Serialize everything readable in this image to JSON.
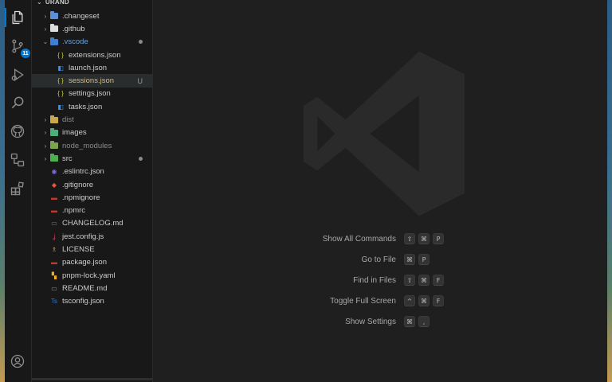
{
  "explorer": {
    "section_title": "URAND",
    "items": [
      {
        "label": ".changeset",
        "type": "folder",
        "chevron": "›",
        "depth": 0,
        "icon_color": "#5b8fd6",
        "icon": "folder-changeset-icon"
      },
      {
        "label": ".github",
        "type": "folder",
        "chevron": "›",
        "depth": 0,
        "icon_color": "#dddddd",
        "icon": "github-folder-icon"
      },
      {
        "label": ".vscode",
        "type": "folder",
        "chevron": "⌄",
        "depth": 0,
        "icon_color": "#3f7fd3",
        "icon": "vscode-folder-icon",
        "state": "accent",
        "status": "dot"
      },
      {
        "label": "extensions.json",
        "type": "file",
        "depth": 1,
        "glyph": "{ }",
        "icon_color": "#cbcb41",
        "icon": "json-file-icon"
      },
      {
        "label": "launch.json",
        "type": "file",
        "depth": 1,
        "glyph": "◧",
        "icon_color": "#3b8eea",
        "icon": "vscode-file-icon"
      },
      {
        "label": "sessions.json",
        "type": "file",
        "depth": 1,
        "glyph": "{ }",
        "icon_color": "#cbcb41",
        "icon": "json-file-icon",
        "state": "selected",
        "status": "U"
      },
      {
        "label": "settings.json",
        "type": "file",
        "depth": 1,
        "glyph": "{ }",
        "icon_color": "#cbcb41",
        "icon": "json-file-icon"
      },
      {
        "label": "tasks.json",
        "type": "file",
        "depth": 1,
        "glyph": "◧",
        "icon_color": "#3b8eea",
        "icon": "vscode-file-icon"
      },
      {
        "label": "dist",
        "type": "folder",
        "chevron": "›",
        "depth": 0,
        "icon_color": "#c9a94b",
        "icon": "dist-folder-icon",
        "state": "dim"
      },
      {
        "label": "images",
        "type": "folder",
        "chevron": "›",
        "depth": 0,
        "icon_color": "#4bb07a",
        "icon": "images-folder-icon"
      },
      {
        "label": "node_modules",
        "type": "folder",
        "chevron": "›",
        "depth": 0,
        "icon_color": "#7ea34f",
        "icon": "node-modules-folder-icon",
        "state": "dim"
      },
      {
        "label": "src",
        "type": "folder",
        "chevron": "›",
        "depth": 0,
        "icon_color": "#4caf50",
        "icon": "src-folder-icon",
        "status": "dot"
      },
      {
        "label": ".eslintrc.json",
        "type": "file",
        "depth": 0,
        "glyph": "◉",
        "icon_color": "#7b6fe0",
        "icon": "eslint-icon"
      },
      {
        "label": ".gitignore",
        "type": "file",
        "depth": 0,
        "glyph": "◆",
        "icon_color": "#e4573a",
        "icon": "git-icon"
      },
      {
        "label": ".npmignore",
        "type": "file",
        "depth": 0,
        "glyph": "▬",
        "icon_color": "#c0392b",
        "icon": "npm-icon"
      },
      {
        "label": ".npmrc",
        "type": "file",
        "depth": 0,
        "glyph": "▬",
        "icon_color": "#c0392b",
        "icon": "npm-icon"
      },
      {
        "label": "CHANGELOG.md",
        "type": "file",
        "depth": 0,
        "glyph": "▭",
        "icon_color": "#777777",
        "icon": "changelog-icon"
      },
      {
        "label": "jest.config.js",
        "type": "file",
        "depth": 0,
        "glyph": "ʝ",
        "icon_color": "#c2415a",
        "icon": "jest-icon"
      },
      {
        "label": "LICENSE",
        "type": "file",
        "depth": 0,
        "glyph": "♗",
        "icon_color": "#d4a736",
        "icon": "license-icon"
      },
      {
        "label": "package.json",
        "type": "file",
        "depth": 0,
        "glyph": "▬",
        "icon_color": "#c0392b",
        "icon": "npm-package-icon"
      },
      {
        "label": "pnpm-lock.yaml",
        "type": "file",
        "depth": 0,
        "glyph": "▚",
        "icon_color": "#f2b01e",
        "icon": "pnpm-icon"
      },
      {
        "label": "README.md",
        "type": "file",
        "depth": 0,
        "glyph": "▭",
        "icon_color": "#8a8a8a",
        "icon": "readme-icon"
      },
      {
        "label": "tsconfig.json",
        "type": "file",
        "depth": 0,
        "glyph": "Ts",
        "icon_color": "#3178c6",
        "icon": "typescript-icon"
      }
    ]
  },
  "activity_bar": {
    "scm_badge": "11",
    "icons": [
      "explorer-icon",
      "source-control-icon",
      "run-debug-icon",
      "search-icon",
      "github-icon",
      "remote-explorer-icon",
      "extensions-icon",
      "account-icon"
    ]
  },
  "welcome": {
    "commands": [
      {
        "label": "Show All Commands",
        "keys": [
          "⇧",
          "⌘",
          "P"
        ]
      },
      {
        "label": "Go to File",
        "keys": [
          "⌘",
          "P"
        ]
      },
      {
        "label": "Find in Files",
        "keys": [
          "⇧",
          "⌘",
          "F"
        ]
      },
      {
        "label": "Toggle Full Screen",
        "keys": [
          "^",
          "⌘",
          "F"
        ]
      },
      {
        "label": "Show Settings",
        "keys": [
          "⌘",
          ","
        ]
      }
    ]
  },
  "colors": {
    "accent": "#0078d4",
    "background": "#1f1f1f",
    "sidebar": "#181818",
    "selected_row": "#2a2d2e",
    "logo": "#2a2a2a"
  }
}
